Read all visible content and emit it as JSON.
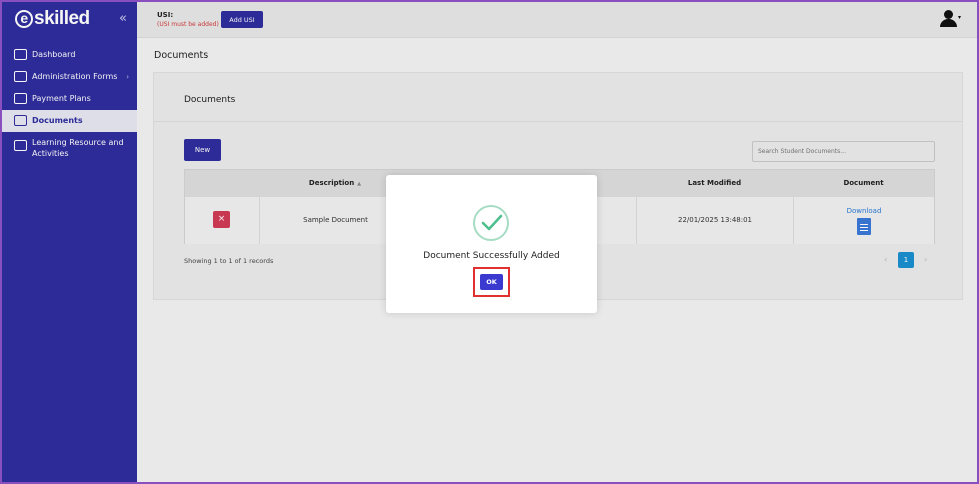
{
  "brand": {
    "logo_text": "skilled",
    "logo_initial": "e"
  },
  "sidebar": {
    "collapse_icon": "«",
    "items": [
      {
        "label": "Dashboard",
        "icon": "chart-line-icon"
      },
      {
        "label": "Administration Forms",
        "icon": "form-icon",
        "chevron": "›"
      },
      {
        "label": "Payment Plans",
        "icon": "credit-card-icon"
      },
      {
        "label": "Documents",
        "icon": "document-icon",
        "active": true
      },
      {
        "label": "Learning Resource and Activities",
        "icon": "presentation-icon"
      }
    ]
  },
  "topbar": {
    "usi_label": "USI:",
    "usi_warning": "(USI must be added)",
    "add_usi_label": "Add USI"
  },
  "page": {
    "title": "Documents",
    "card_title": "Documents",
    "new_label": "New",
    "search_placeholder": "Search Student Documents...",
    "table": {
      "columns": [
        "",
        "Description",
        "",
        "Last Modified",
        "Document"
      ],
      "rows": [
        {
          "delete_icon": "×",
          "description": "Sample Document",
          "last_modified": "22/01/2025 13:48:01",
          "download": "Download"
        }
      ]
    },
    "records_text": "Showing 1 to 1 of 1 records",
    "pagination": {
      "prev": "‹",
      "current": "1",
      "next": "›"
    }
  },
  "modal": {
    "message": "Document Successfully Added",
    "ok_label": "OK"
  },
  "colors": {
    "sidebar": "#2e2d9e",
    "accent": "#3a3ad0",
    "danger": "#d23b55",
    "success": "#4cbf8c",
    "link": "#2a7bd4"
  }
}
